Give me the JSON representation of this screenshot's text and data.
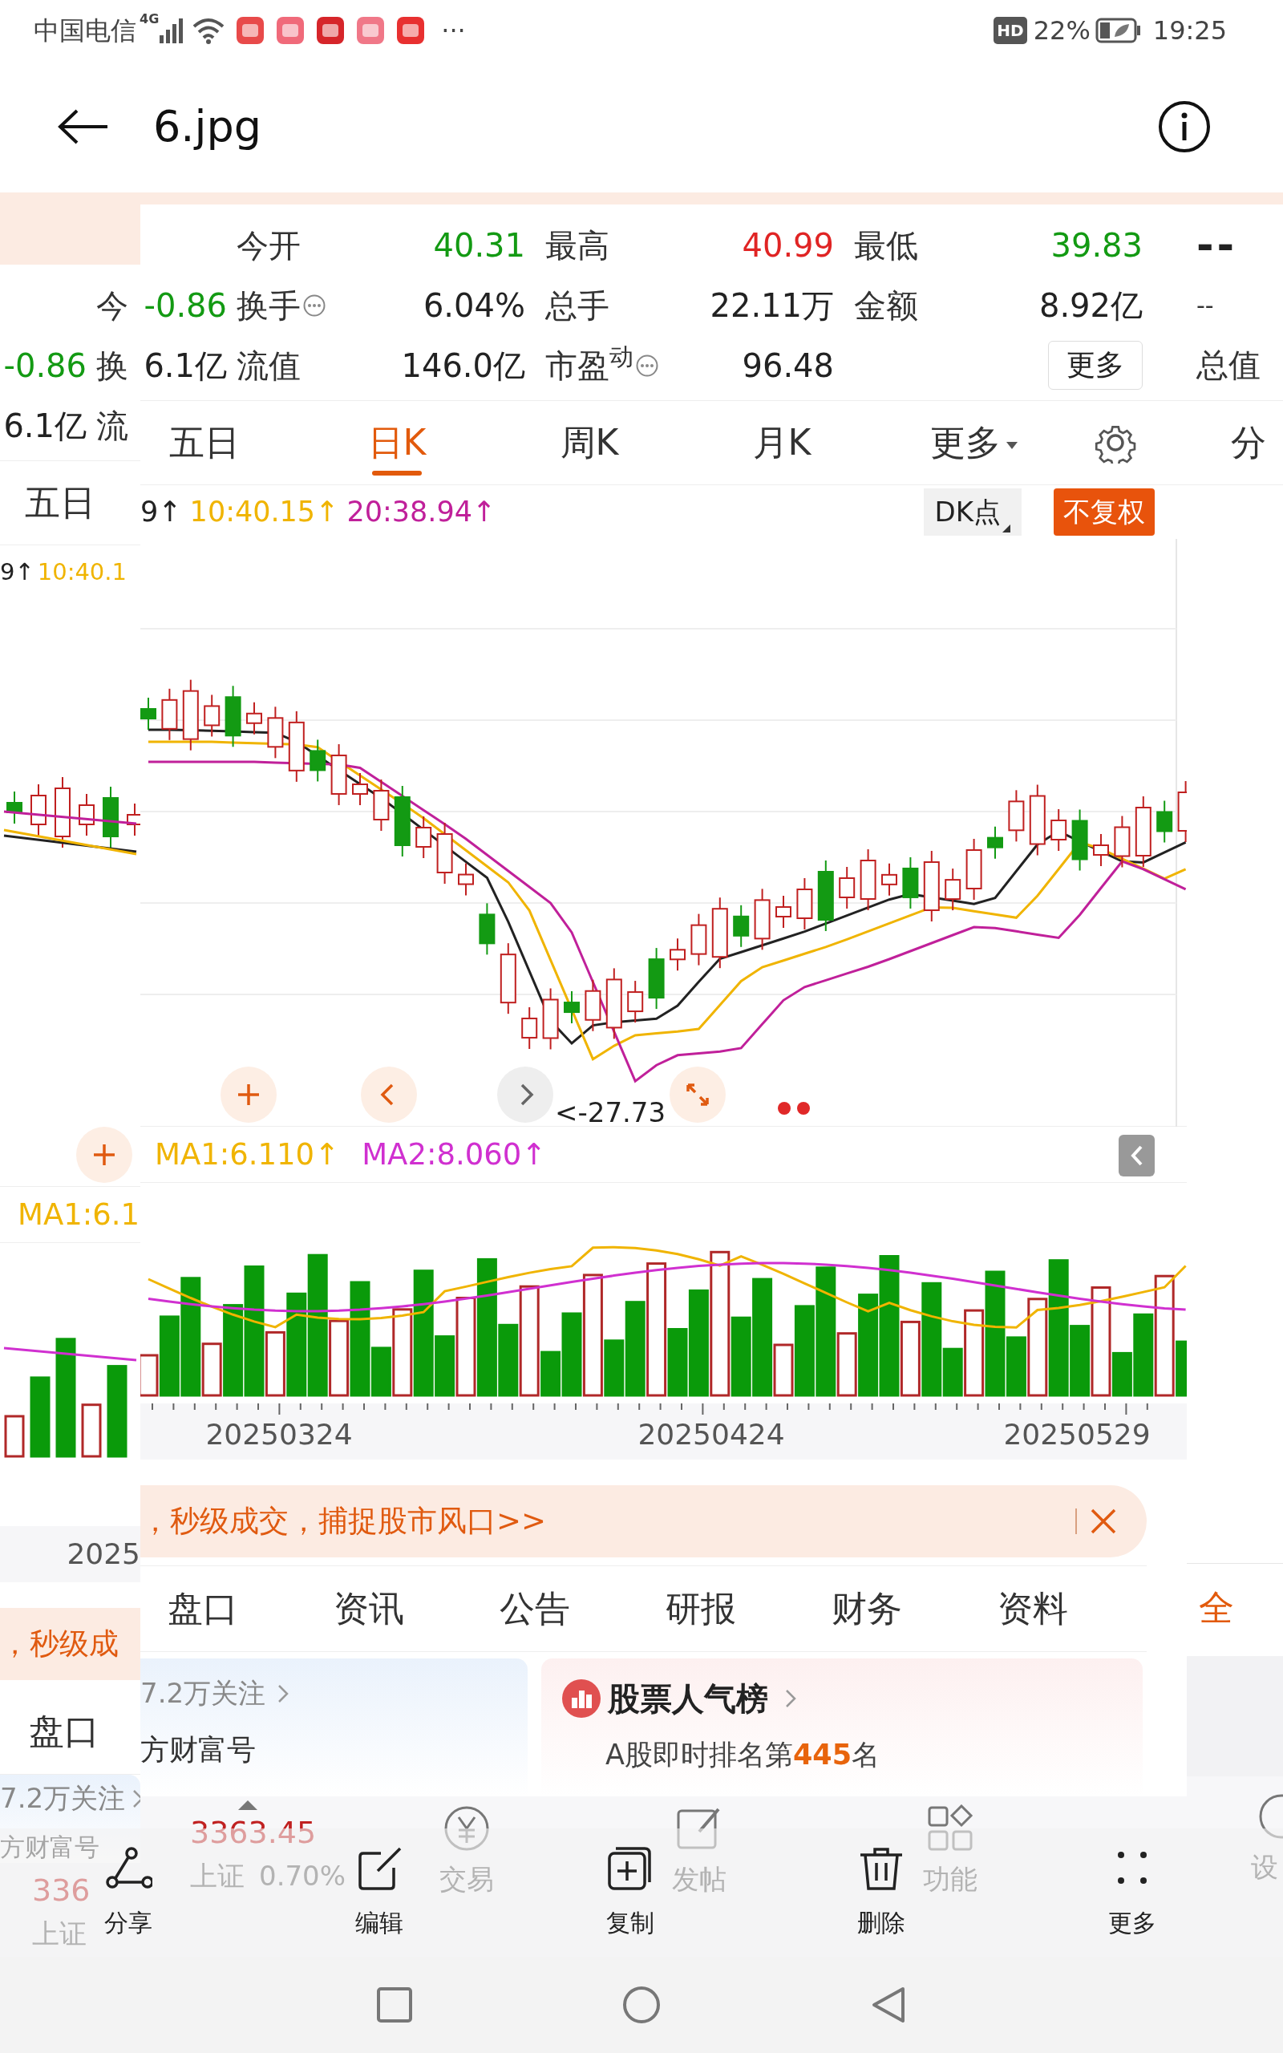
{
  "status_bar": {
    "carrier": "中国电信",
    "network": "4G",
    "more": "···",
    "hd": "HD",
    "battery": "22%",
    "time": "19:25"
  },
  "viewer": {
    "title": "6.jpg"
  },
  "quote_rows": [
    {
      "cells": [
        {
          "label": "今开",
          "value": "40.31",
          "color": "#139a13"
        },
        {
          "label": "最高",
          "value": "40.99",
          "color": "#e02424"
        },
        {
          "label": "最低",
          "value": "39.83",
          "color": "#139a13"
        }
      ]
    },
    {
      "lead": {
        "value": "-0.86",
        "color": "#139a13"
      },
      "cells": [
        {
          "label": "换手",
          "value": "6.04%",
          "color": "#222222",
          "info_icon": true
        },
        {
          "label": "总手",
          "value": "22.11万",
          "color": "#222222"
        },
        {
          "label": "金额",
          "value": "8.92亿",
          "color": "#222222"
        }
      ]
    },
    {
      "lead": {
        "value": "6.1亿",
        "color": "#222222"
      },
      "cells": [
        {
          "label": "流值",
          "value": "146.0亿",
          "color": "#222222"
        },
        {
          "label": "市盈$^{动}$",
          "value": "96.48",
          "color": "#222222",
          "info_icon": true
        }
      ],
      "more_button": "更多"
    }
  ],
  "chart_tabs": [
    {
      "label": "五日",
      "selected": false
    },
    {
      "label": "日K",
      "selected": true
    },
    {
      "label": "周K",
      "selected": false
    },
    {
      "label": "月K",
      "selected": false
    },
    {
      "label": "更多",
      "selected": false,
      "dropdown": true
    }
  ],
  "indicator": [
    {
      "text": "9↑",
      "color": "#222222"
    },
    {
      "text": "10:40.15↑",
      "color": "#f0b400"
    },
    {
      "text": "20:38.94↑",
      "color": "#c0209a"
    }
  ],
  "dk_button": "DK点",
  "adjust_badge": "不复权",
  "price_label": "<-27.73",
  "ma_legend": [
    {
      "text": "MA1:6.110↑",
      "color": "#f0b400"
    },
    {
      "text": "MA2:8.060↑",
      "color": "#d030d0"
    }
  ],
  "dates": [
    "20250324",
    "20250424",
    "20250529"
  ],
  "banner": "，秒级成交，捕捉股市风口>>",
  "info_tabs": [
    "盘口",
    "资讯",
    "公告",
    "研报",
    "财务",
    "资料"
  ],
  "cards": {
    "follow": "7.2万关注",
    "account": "方财富号",
    "rank_title": "股票人气榜",
    "rank_text": "A股即时排名第**445**名"
  },
  "under_nav": {
    "index_value": "3363.45",
    "index_name": "上证",
    "index_change": "0.70%",
    "items": [
      "交易",
      "发帖",
      "功能"
    ]
  },
  "left_layer": {
    "quote_labels": [
      "今",
      "换",
      "流"
    ],
    "quote_values": [
      {
        "value": "-0.86",
        "color": "#139a13"
      },
      {
        "value": "6.1亿",
        "color": "#222222"
      }
    ],
    "tab": "五日",
    "indicator": [
      {
        "text": "9↑",
        "color": "#222222"
      },
      {
        "text": "10:40.1",
        "color": "#f0b400"
      }
    ],
    "ma": "MA1:6.1",
    "date": "2025",
    "banner": "，秒级成",
    "info_tab": "盘口",
    "follow": "7.2万关注",
    "account": "方财富号",
    "index_value": "336",
    "index_name": "上证"
  },
  "right_layer": {
    "quote_values": [
      "--",
      "--"
    ],
    "quote_label": "总值",
    "tab": "分",
    "info_tab": "全",
    "nav_item": "设"
  },
  "toolbar": [
    {
      "label": "分享",
      "kind": "share"
    },
    {
      "label": "编辑",
      "kind": "edit"
    },
    {
      "label": "复制",
      "kind": "copy"
    },
    {
      "label": "删除",
      "kind": "delete"
    },
    {
      "label": "更多",
      "kind": "more"
    }
  ]
}
